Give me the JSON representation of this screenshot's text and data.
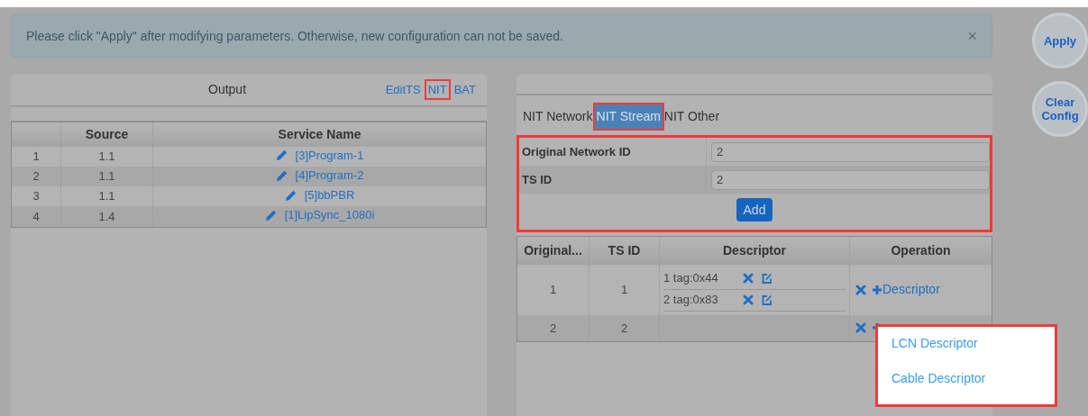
{
  "alert": {
    "text": "Please click \"Apply\" after modifying parameters. Otherwise, new configuration can not be saved.",
    "close": "×"
  },
  "side_buttons": [
    {
      "label": "Apply"
    },
    {
      "label": "Clear Config"
    }
  ],
  "output_panel": {
    "title": "Output",
    "links": [
      {
        "label": "EditTS",
        "highlighted": false
      },
      {
        "label": "NIT",
        "highlighted": true
      },
      {
        "label": "BAT",
        "highlighted": false
      }
    ],
    "columns": [
      "",
      "Source",
      "Service Name"
    ],
    "rows": [
      {
        "index": "1",
        "source": "1.1",
        "service": "[3]Program-1"
      },
      {
        "index": "2",
        "source": "1.1",
        "service": "[4]Program-2"
      },
      {
        "index": "3",
        "source": "1.1",
        "service": "[5]bbPBR"
      },
      {
        "index": "4",
        "source": "1.4",
        "service": "[1]LipSync_1080i"
      }
    ]
  },
  "nit_panel": {
    "tabs": [
      {
        "label": "NIT Network",
        "selected": false,
        "highlighted": false
      },
      {
        "label": "NIT Stream",
        "selected": true,
        "highlighted": true
      },
      {
        "label": "NIT Other",
        "selected": false,
        "highlighted": false
      }
    ],
    "form": {
      "highlighted": true,
      "fields": [
        {
          "label": "Original Network ID",
          "value": "2"
        },
        {
          "label": "TS ID",
          "value": "2"
        }
      ],
      "add_button": "Add"
    },
    "columns": [
      "Original...",
      "TS ID",
      "Descriptor",
      "Operation"
    ],
    "rows": [
      {
        "network_id": "1",
        "ts_id": "1",
        "descriptors": [
          "1 tag:0x44",
          "2 tag:0x83"
        ],
        "add_label": "Descriptor"
      },
      {
        "network_id": "2",
        "ts_id": "2",
        "descriptors": []
      }
    ],
    "menu": {
      "highlighted": true,
      "items": [
        "LCN Descriptor",
        "Cable Descriptor"
      ]
    }
  }
}
